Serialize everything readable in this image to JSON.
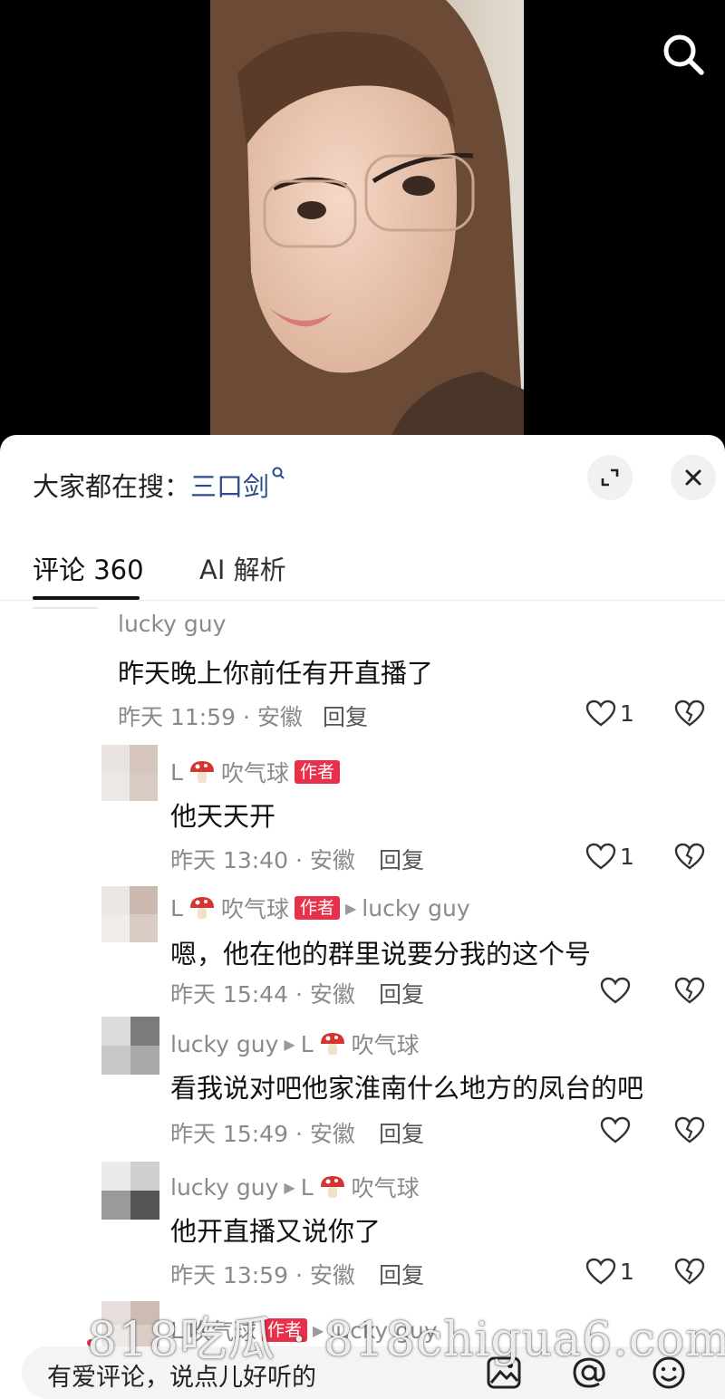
{
  "video": {
    "search_icon": "search-icon"
  },
  "sheet": {
    "hot_search_prefix": "大家都在搜：",
    "hot_search_term": "三口剑",
    "expand_icon": "expand-icon",
    "close_icon": "close-icon"
  },
  "tabs": [
    {
      "label": "评论 360",
      "active": true
    },
    {
      "label": "AI 解析",
      "active": false
    }
  ],
  "comments": [
    {
      "user": "lucky guy",
      "text": "昨天晚上你前任有开直播了",
      "meta": "昨天 11:59 · 安徽",
      "reply": "回复",
      "likes": "1"
    },
    {
      "user": "L",
      "user_suffix": "吹气球",
      "badge": "作者",
      "text": "他天天开",
      "meta": "昨天 13:40 · 安徽",
      "reply": "回复",
      "likes": "1"
    },
    {
      "user": "L",
      "user_suffix": "吹气球",
      "badge": "作者",
      "reply_to": "lucky guy",
      "text": "嗯，他在他的群里说要分我的这个号",
      "meta": "昨天 15:44 · 安徽",
      "reply": "回复",
      "likes": ""
    },
    {
      "user": "lucky guy",
      "reply_to_prefix": "L",
      "reply_to_suffix": "吹气球",
      "text": "看我说对吧他家淮南什么地方的凤台的吧",
      "meta": "昨天 15:49 · 安徽",
      "reply": "回复",
      "likes": ""
    },
    {
      "user": "lucky guy",
      "reply_to_prefix": "L",
      "reply_to_suffix": "吹气球",
      "text": "他开直播又说你了",
      "meta": "昨天 13:59 · 安徽",
      "reply": "回复",
      "likes": "1"
    },
    {
      "user": "L",
      "user_suffix": "吹气球",
      "badge": "作者",
      "reply_to": "lucky guy"
    }
  ],
  "input": {
    "placeholder": "有爱评论，说点儿好听的",
    "image_icon": "image-icon",
    "at_icon": "at-icon",
    "emoji_icon": "emoji-icon"
  },
  "watermark": "818吃瓜 · 818chigua6.com",
  "colors": {
    "badge": "#e8304b",
    "link": "#2c4a8c",
    "meta": "#8a8a8a"
  }
}
